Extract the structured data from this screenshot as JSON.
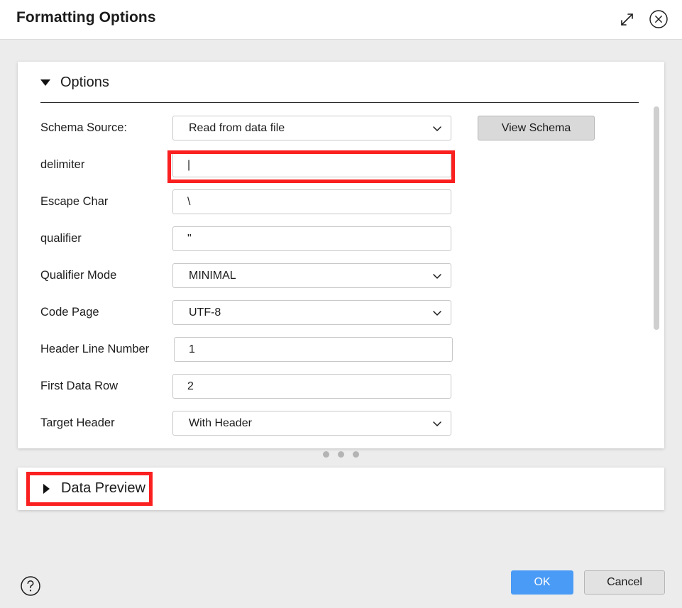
{
  "titlebar": {
    "title": "Formatting Options",
    "expand_icon": "expand-diagonal-icon",
    "close_icon": "close-circle-icon"
  },
  "options_section": {
    "title": "Options",
    "expanded": true,
    "toggle_icon": "triangle-down-icon",
    "view_schema_label": "View Schema",
    "fields": [
      {
        "label": "Schema Source:",
        "value": "Read from data file",
        "type": "select",
        "highlighted": false
      },
      {
        "label": "delimiter",
        "value": "|",
        "type": "input",
        "highlighted": true
      },
      {
        "label": "Escape Char",
        "value": "\\",
        "type": "input",
        "highlighted": false
      },
      {
        "label": "qualifier",
        "value": "\"",
        "type": "input",
        "highlighted": false
      },
      {
        "label": "Qualifier Mode",
        "value": "MINIMAL",
        "type": "select",
        "highlighted": false
      },
      {
        "label": "Code Page",
        "value": "UTF-8",
        "type": "select",
        "highlighted": false
      },
      {
        "label": "Header Line Number",
        "value": "1",
        "type": "input",
        "highlighted": false
      },
      {
        "label": "First Data Row",
        "value": "2",
        "type": "input",
        "highlighted": false
      },
      {
        "label": "Target Header",
        "value": "With Header",
        "type": "select",
        "highlighted": false
      }
    ]
  },
  "data_preview_section": {
    "title": "Data Preview",
    "expanded": false,
    "toggle_icon": "triangle-right-icon",
    "highlighted": true
  },
  "footer": {
    "help_icon": "help-circle-icon",
    "ok_label": "OK",
    "cancel_label": "Cancel"
  },
  "colors": {
    "accent_blue": "#4a9bf5",
    "highlight_red": "#fa2020",
    "page_background": "#ececec",
    "panel_background": "#ffffff",
    "button_gray": "#d9d9d9"
  }
}
